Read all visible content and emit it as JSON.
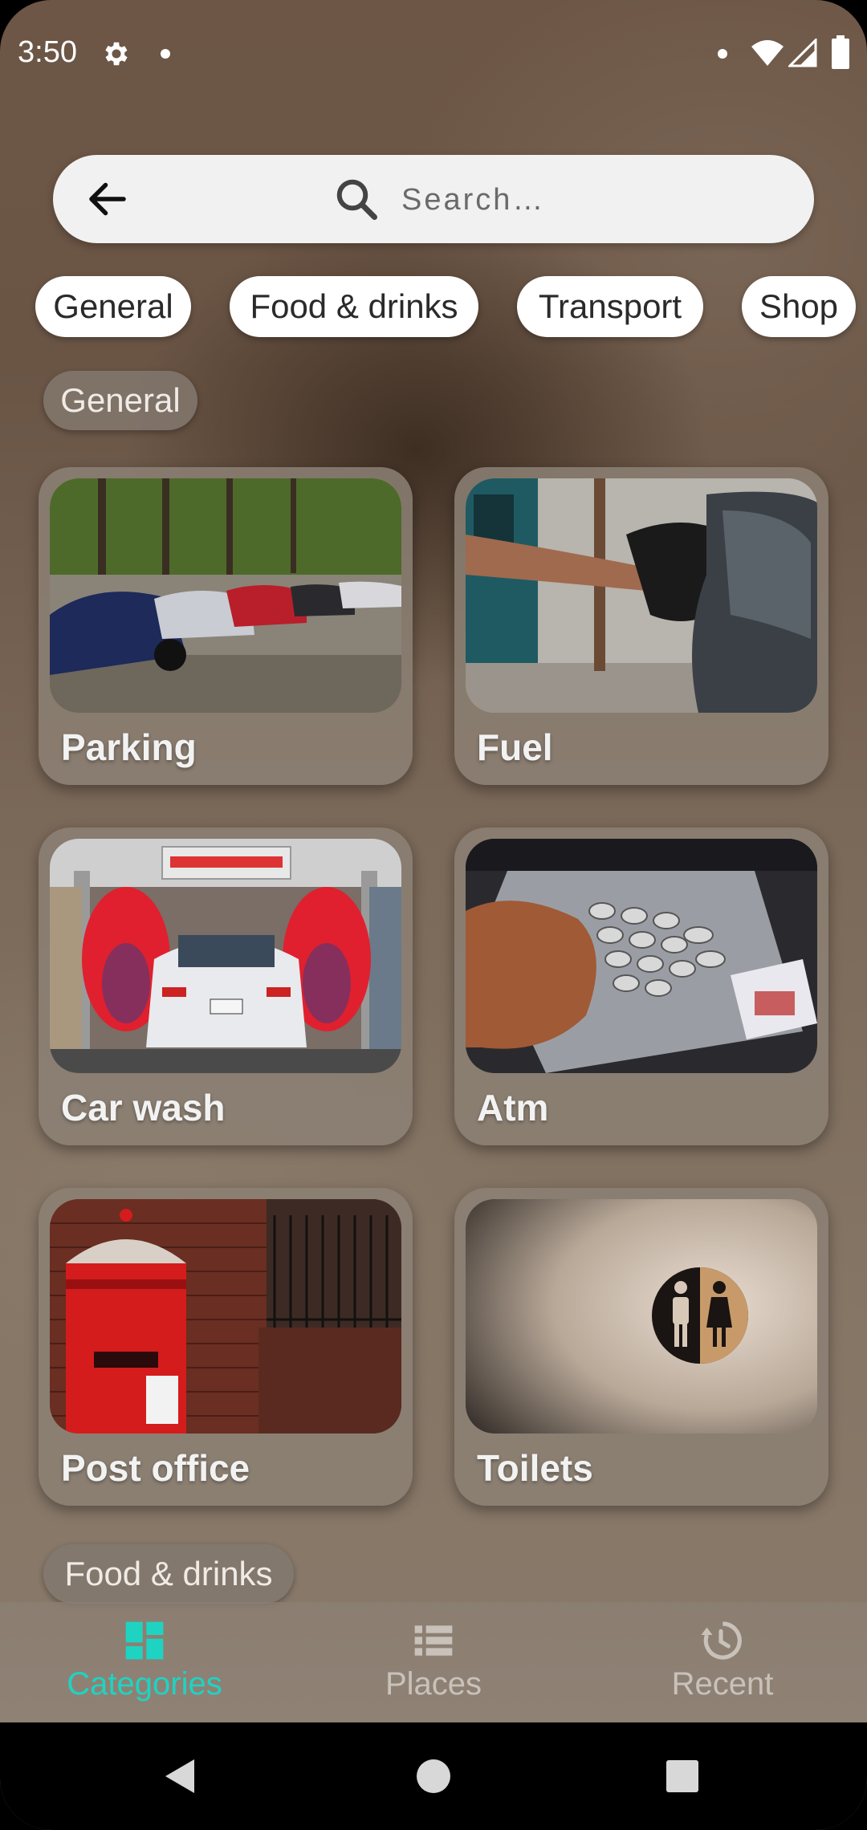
{
  "status_bar": {
    "time": "3:50",
    "icons": [
      "gear-icon",
      "notification-dot-icon",
      "notification-dot-icon",
      "wifi-icon",
      "signal-icon",
      "battery-icon"
    ]
  },
  "search": {
    "placeholder": "Search…",
    "value": "",
    "back_icon": "arrow-left-icon",
    "search_icon": "magnifier-icon"
  },
  "chips": [
    {
      "label": "General"
    },
    {
      "label": "Food & drinks"
    },
    {
      "label": "Transport"
    },
    {
      "label": "Shop"
    }
  ],
  "sections": [
    {
      "label": "General",
      "cards": [
        {
          "title": "Parking",
          "image": "parked-cars-photo"
        },
        {
          "title": "Fuel",
          "image": "fuel-pump-photo"
        },
        {
          "title": "Car wash",
          "image": "car-wash-photo"
        },
        {
          "title": "Atm",
          "image": "atm-keypad-photo"
        },
        {
          "title": "Post office",
          "image": "red-postbox-photo"
        },
        {
          "title": "Toilets",
          "image": "restroom-sign-photo"
        }
      ]
    },
    {
      "label": "Food & drinks"
    }
  ],
  "bottom_nav": {
    "items": [
      {
        "label": "Categories",
        "icon": "grid-icon",
        "active": true
      },
      {
        "label": "Places",
        "icon": "list-icon",
        "active": false
      },
      {
        "label": "Recent",
        "icon": "history-icon",
        "active": false
      }
    ]
  },
  "colors": {
    "accent": "#1fd3c2",
    "inactive_nav": "#c9c2ba",
    "chip_bg": "#ffffff",
    "card_bg": "#8c8074"
  },
  "system_nav": {
    "icons": [
      "back-triangle-icon",
      "home-circle-icon",
      "recents-square-icon"
    ]
  }
}
